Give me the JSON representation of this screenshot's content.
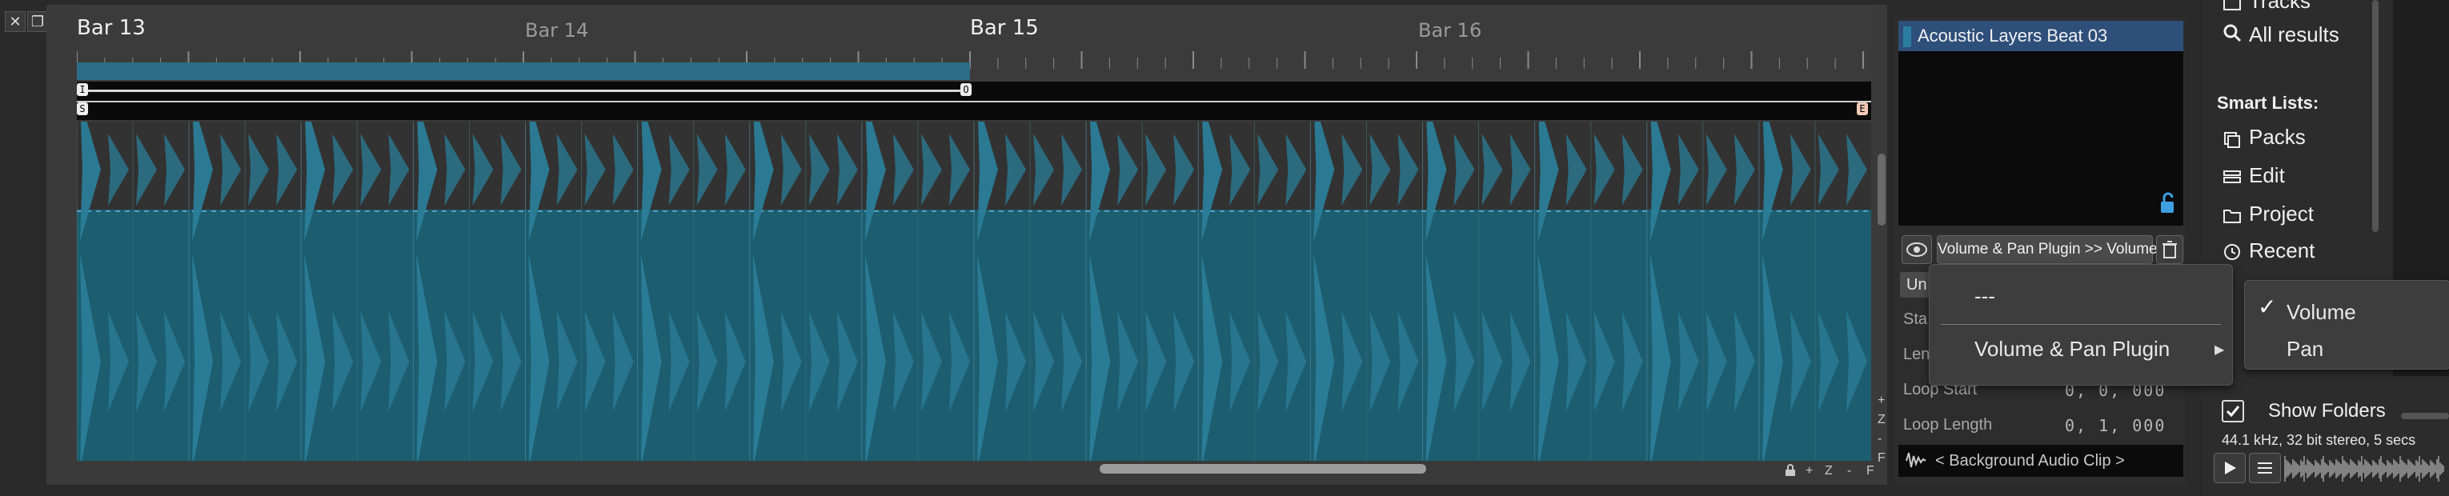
{
  "window_controls": {
    "close_icon": "close-icon",
    "restore_icon": "restore-icon"
  },
  "ruler": {
    "bars": [
      {
        "label": "Bar 13",
        "major": true
      },
      {
        "label": "Bar 14",
        "major": false
      },
      {
        "label": "Bar 15",
        "major": true
      },
      {
        "label": "Bar 16",
        "major": false
      }
    ],
    "markers": {
      "in": "I",
      "out": "O",
      "start": "S",
      "end": "E"
    }
  },
  "clip": {
    "waveform_color": "#2b7d98",
    "body_color": "#1d5d70"
  },
  "zoom_controls": {
    "plus": "+",
    "z": "Z",
    "minus": "-",
    "f": "F"
  },
  "inspector": {
    "clip_name": "Acoustic Layers Beat 03",
    "automation_param": "Volume & Pan Plugin >> Volume",
    "partial_button": "Un",
    "props": [
      {
        "label": "Sta",
        "value": ""
      },
      {
        "label": "Len",
        "value": ""
      },
      {
        "label": "Loop Start",
        "value": "0, 0, 000"
      },
      {
        "label": "Loop Length",
        "value": "0, 1, 000"
      }
    ],
    "background_clip": "< Background Audio Clip >"
  },
  "menu": {
    "items": [
      "---",
      "Volume & Pan Plugin"
    ],
    "submenu": [
      {
        "label": "Volume",
        "checked": true
      },
      {
        "label": "Pan",
        "checked": false
      }
    ]
  },
  "browser": {
    "top_cut": "Tracks",
    "all_results": "All results",
    "smart_lists_title": "Smart Lists:",
    "smart_lists": [
      "Packs",
      "Edit",
      "Project",
      "Recent"
    ],
    "show_folders": "Show Folders",
    "file_info": "44.1 kHz, 32 bit stereo, 5 secs"
  }
}
